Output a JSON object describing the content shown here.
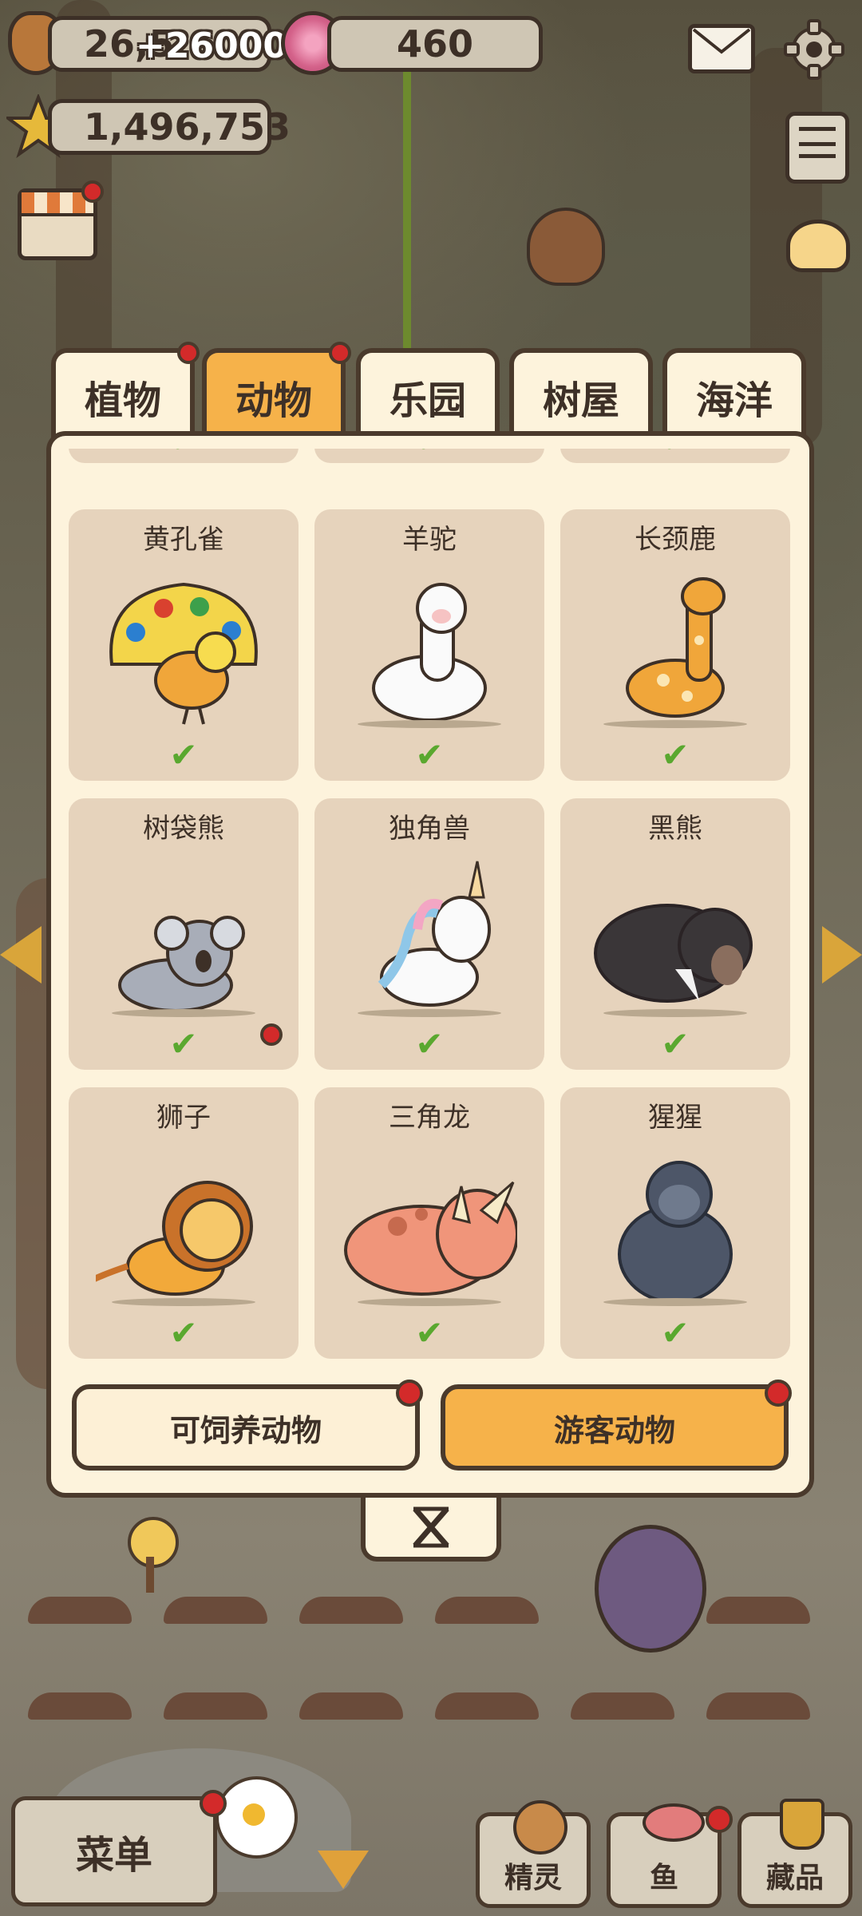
{
  "hud": {
    "acorn_count": "26,5",
    "acorn_gain": "+26000",
    "candy_count": "460",
    "star_count": "1,496,753"
  },
  "tabs": [
    {
      "label": "植物",
      "badge": true
    },
    {
      "label": "动物",
      "badge": true,
      "active": true
    },
    {
      "label": "乐园",
      "badge": false
    },
    {
      "label": "树屋",
      "badge": false
    },
    {
      "label": "海洋",
      "badge": false
    }
  ],
  "animals": [
    {
      "name": "黄孔雀",
      "check": "✔"
    },
    {
      "name": "羊驼",
      "check": "✔"
    },
    {
      "name": "长颈鹿",
      "check": "✔"
    },
    {
      "name": "树袋熊",
      "check": "✔"
    },
    {
      "name": "独角兽",
      "check": "✔"
    },
    {
      "name": "黑熊",
      "check": "✔"
    },
    {
      "name": "狮子",
      "check": "✔"
    },
    {
      "name": "三角龙",
      "check": "✔"
    },
    {
      "name": "猩猩",
      "check": "✔"
    }
  ],
  "partial_row_check": "✔",
  "buttons": {
    "feedable": "可饲养动物",
    "visitor": "游客动物"
  },
  "bottom_bar": {
    "menu": "菜单",
    "spirit": "精灵",
    "fish": "鱼",
    "collection": "藏品"
  },
  "colors": {
    "tab_active": "#f6b24a",
    "panel": "#fdf3dc",
    "card": "#e6d3bc",
    "badge": "#d32a2a",
    "check": "#5aa82f"
  }
}
